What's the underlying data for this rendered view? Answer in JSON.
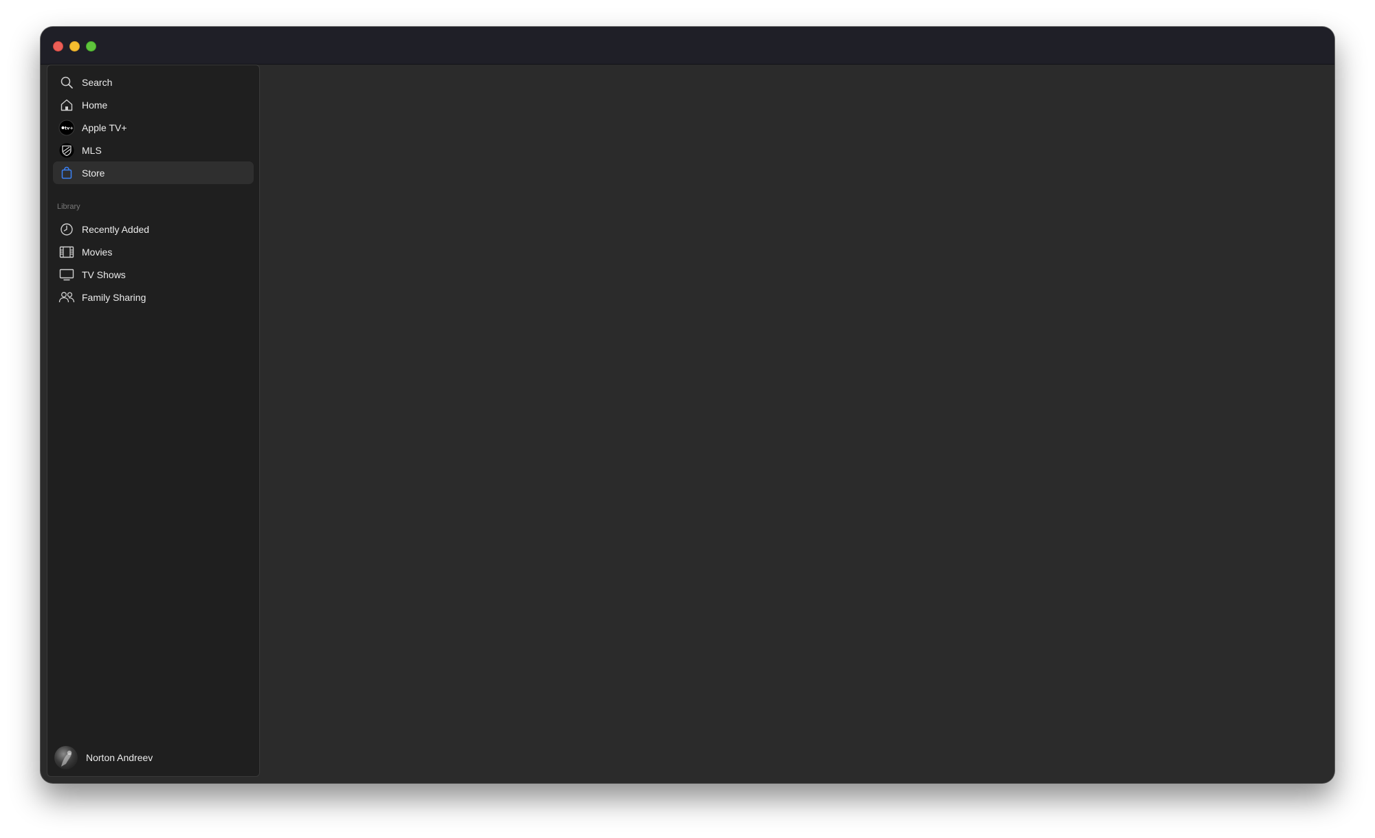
{
  "window": {
    "traffic_lights": {
      "close_color": "#ec5f57",
      "minimize_color": "#f4bc2f",
      "zoom_color": "#5fc43c"
    }
  },
  "sidebar": {
    "primary_items": [
      {
        "label": "Search",
        "icon": "magnifying-glass-icon",
        "selected": false
      },
      {
        "label": "Home",
        "icon": "house-icon",
        "selected": false
      },
      {
        "label": "Apple TV+",
        "icon": "apple-tv-plus-icon",
        "selected": false
      },
      {
        "label": "MLS",
        "icon": "mls-shield-icon",
        "selected": false
      },
      {
        "label": "Store",
        "icon": "shopping-bag-icon",
        "selected": true
      }
    ],
    "library_header": "Library",
    "library_items": [
      {
        "label": "Recently Added",
        "icon": "clock-icon"
      },
      {
        "label": "Movies",
        "icon": "film-strip-icon"
      },
      {
        "label": "TV Shows",
        "icon": "tv-monitor-icon"
      },
      {
        "label": "Family Sharing",
        "icon": "people-icon"
      }
    ],
    "profile": {
      "name": "Norton Andreev"
    }
  },
  "colors": {
    "accent": "#3b82f6",
    "sidebar_bg": "#1f1f1f",
    "content_bg": "#2b2b2b",
    "titlebar_bg": "#1f1f27"
  }
}
